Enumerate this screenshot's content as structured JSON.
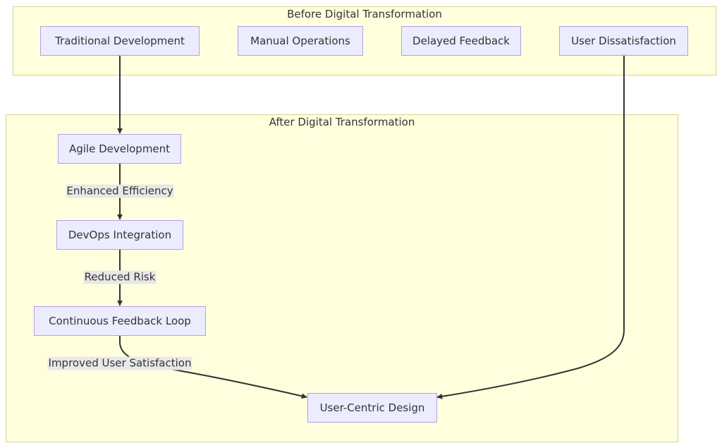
{
  "diagram": {
    "type": "flowchart",
    "clusters": [
      {
        "id": "before",
        "title": "Before Digital Transformation"
      },
      {
        "id": "after",
        "title": "After Digital Transformation"
      }
    ],
    "nodes": {
      "traditional_development": "Traditional Development",
      "manual_operations": "Manual Operations",
      "delayed_feedback": "Delayed Feedback",
      "user_dissatisfaction": "User Dissatisfaction",
      "agile_development": "Agile Development",
      "devops_integration": "DevOps Integration",
      "continuous_feedback_loop": "Continuous Feedback Loop",
      "user_centric_design": "User-Centric Design"
    },
    "edges": [
      {
        "from": "Traditional Development",
        "to": "Agile Development",
        "label": ""
      },
      {
        "from": "Agile Development",
        "to": "DevOps Integration",
        "label": "Enhanced Efficiency"
      },
      {
        "from": "DevOps Integration",
        "to": "Continuous Feedback Loop",
        "label": "Reduced Risk"
      },
      {
        "from": "Continuous Feedback Loop",
        "to": "User-Centric Design",
        "label": "Improved User Satisfaction"
      },
      {
        "from": "User Dissatisfaction",
        "to": "User-Centric Design",
        "label": ""
      }
    ],
    "colors": {
      "cluster_fill": "#ffffde",
      "cluster_border": "#d4d48a",
      "node_fill": "#ececff",
      "node_border": "#b49ee6",
      "edge": "#333333",
      "edge_label_bg": "#e8e8e8"
    }
  }
}
